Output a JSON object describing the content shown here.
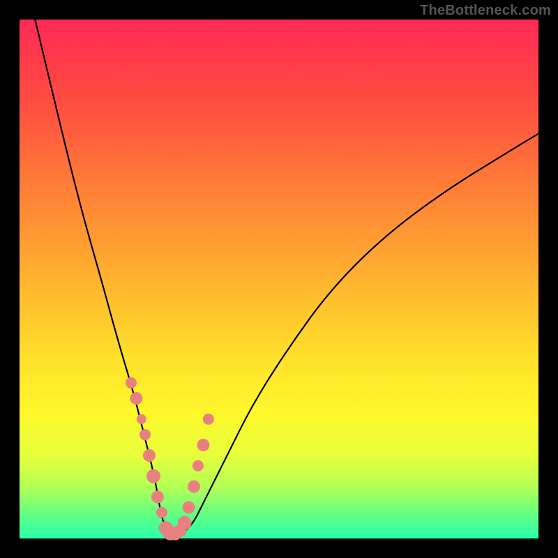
{
  "watermark": "TheBottleneck.com",
  "colors": {
    "page_bg": "#000000",
    "curve_stroke": "#000000",
    "marker_fill": "#e98080",
    "gradient_top": "#ff2a55",
    "gradient_bottom": "#2bffad"
  },
  "chart_data": {
    "type": "line",
    "title": "",
    "xlabel": "",
    "ylabel": "",
    "xlim": [
      0,
      100
    ],
    "ylim": [
      0,
      100
    ],
    "grid": false,
    "legend": false,
    "series": [
      {
        "name": "bottleneck-curve",
        "x": [
          3,
          8,
          12,
          16,
          19,
          22,
          24,
          26,
          27,
          28,
          30,
          33,
          36,
          40,
          45,
          52,
          60,
          70,
          82,
          95,
          100
        ],
        "y": [
          100,
          79,
          63,
          49,
          38,
          28,
          20,
          12,
          6,
          2,
          0.5,
          2,
          8,
          16,
          26,
          37,
          48,
          58,
          67,
          75,
          78
        ]
      }
    ],
    "markers": {
      "name": "highlight-points",
      "x": [
        21.5,
        22.5,
        23.5,
        24.2,
        25.0,
        25.8,
        26.6,
        27.4,
        28.2,
        29.0,
        30.0,
        31.0,
        31.8,
        32.6,
        33.6,
        34.4,
        35.4,
        36.4
      ],
      "y": [
        30,
        27,
        23,
        20,
        16,
        12,
        8,
        5,
        2,
        1,
        1,
        1.5,
        3,
        6,
        10,
        14,
        18,
        23
      ],
      "r": [
        8,
        9,
        7,
        8,
        9,
        10,
        9,
        8,
        10,
        10,
        10,
        9,
        10,
        9,
        9,
        8,
        9,
        8
      ]
    }
  }
}
